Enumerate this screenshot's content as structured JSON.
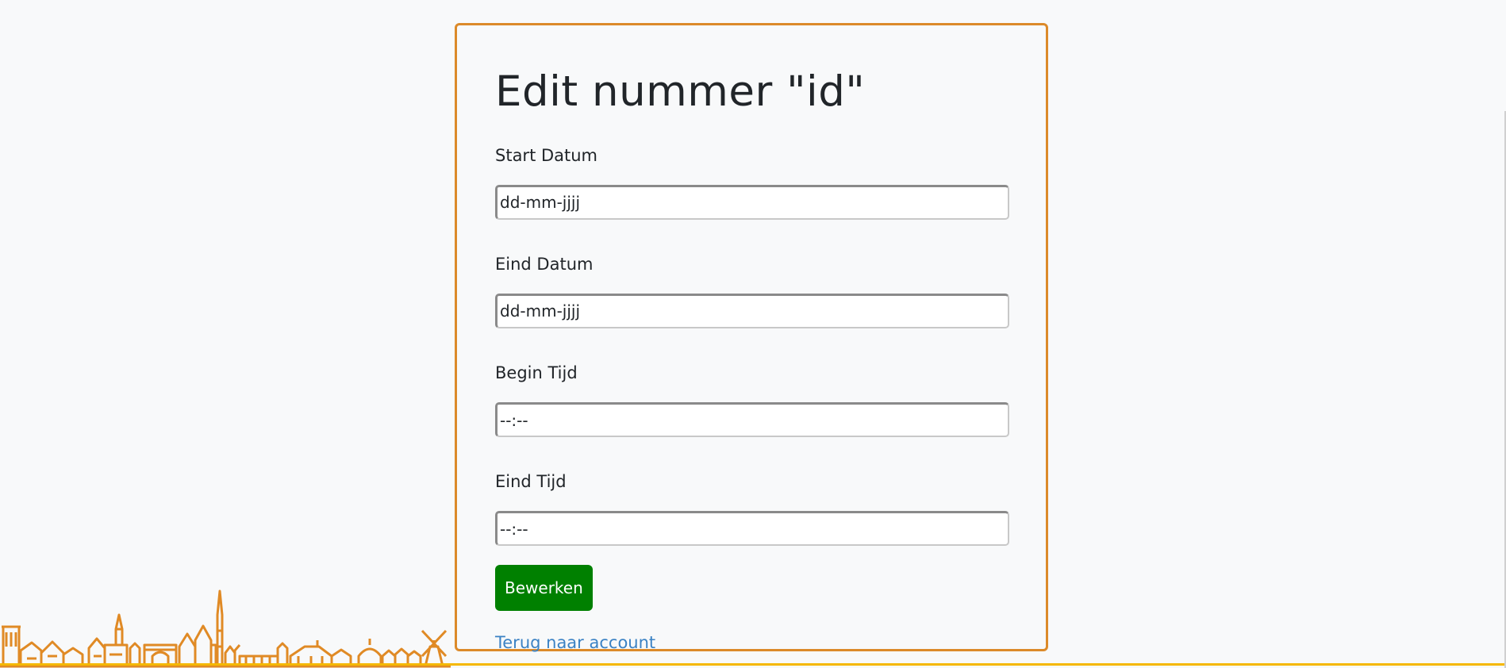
{
  "form": {
    "title": "Edit nummer \"id\"",
    "fields": [
      {
        "label": "Start Datum",
        "placeholder": "dd-mm-jjjj"
      },
      {
        "label": "Eind Datum",
        "placeholder": "dd-mm-jjjj"
      },
      {
        "label": "Begin Tijd",
        "placeholder": "--:--"
      },
      {
        "label": "Eind Tijd",
        "placeholder": "--:--"
      }
    ],
    "submit_label": "Bewerken",
    "back_link": "Terug naar account"
  },
  "colors": {
    "card_border": "#dc8a2a",
    "submit_background": "#008000",
    "link": "#3b82c4",
    "skyline": "#e08a25",
    "bottom_line": "#f5b800"
  },
  "icons": {
    "skyline": "city-skyline-icon"
  }
}
